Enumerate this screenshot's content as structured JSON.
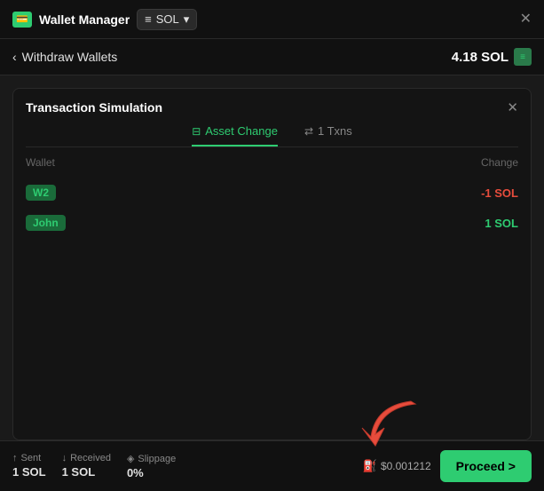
{
  "topbar": {
    "wallet_icon_label": "💳",
    "title": "Wallet Manager",
    "sol_label": "SOL",
    "close_label": "✕"
  },
  "withdraw": {
    "back_arrow": "‹",
    "label": "Withdraw Wallets",
    "amount": "4.18 SOL",
    "filter_icon": "≡"
  },
  "simulation": {
    "title": "Transaction Simulation",
    "close_label": "✕",
    "tabs": [
      {
        "id": "asset-change",
        "icon": "⊟",
        "label": "Asset Change",
        "active": true
      },
      {
        "id": "txns",
        "icon": "⇄",
        "label": "1 Txns",
        "active": false
      }
    ],
    "table": {
      "col_wallet": "Wallet",
      "col_change": "Change",
      "rows": [
        {
          "wallet": "W2",
          "change": "-1 SOL",
          "positive": false
        },
        {
          "wallet": "John",
          "change": "1 SOL",
          "positive": true
        }
      ]
    }
  },
  "footer": {
    "stats": [
      {
        "icon": "↑",
        "label": "Sent",
        "value": "1 SOL"
      },
      {
        "icon": "↓",
        "label": "Received",
        "value": "1 SOL"
      },
      {
        "icon": "◈",
        "label": "Slippage",
        "value": "0%"
      }
    ],
    "gas_icon": "⛽",
    "gas_price": "$0.001212",
    "proceed_label": "Proceed >"
  }
}
